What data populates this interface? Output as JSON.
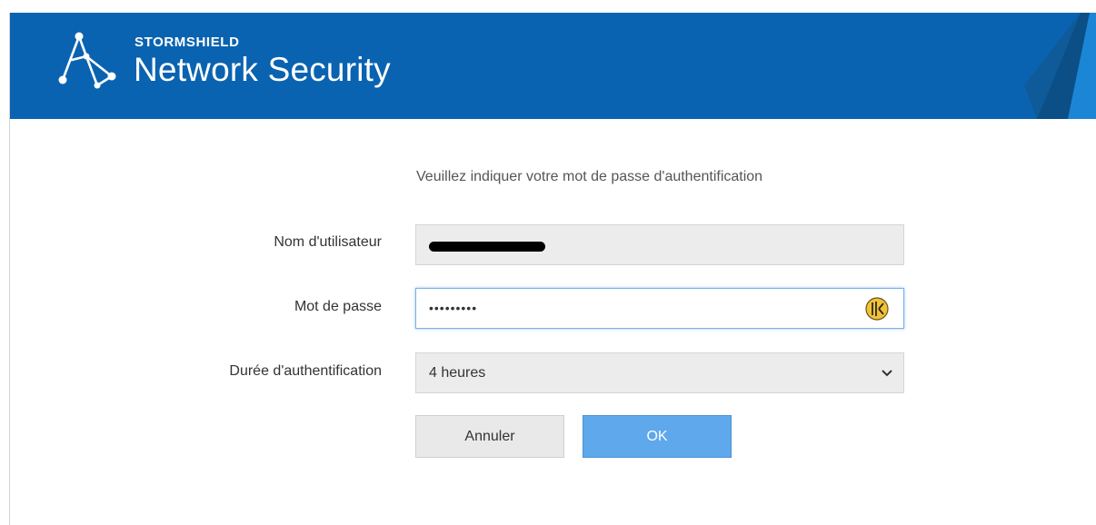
{
  "header": {
    "brand_small": "STORMSHIELD",
    "brand_big": "Network Security",
    "logo_icon": "stormshield-logo-icon",
    "colors": {
      "bar": "#0a63b0",
      "accent": "#1c86d6",
      "deco": "#0b4f86"
    }
  },
  "form": {
    "prompt": "Veuillez indiquer votre mot de passe d'authentification",
    "username_label": "Nom d'utilisateur",
    "username_value": "",
    "password_label": "Mot de passe",
    "password_value": "•••••••••",
    "password_manager_icon": "keeper-icon",
    "duration_label": "Durée d'authentification",
    "duration_selected": "4 heures",
    "cancel_label": "Annuler",
    "ok_label": "OK"
  }
}
